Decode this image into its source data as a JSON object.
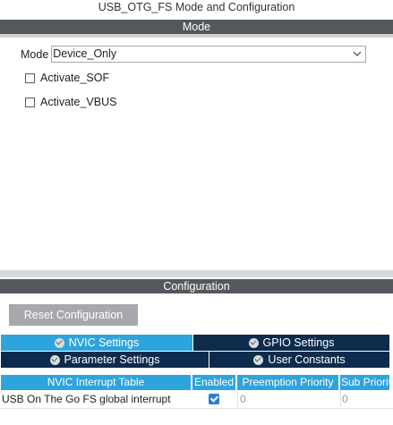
{
  "window": {
    "title": "USB_OTG_FS Mode and Configuration"
  },
  "mode_section": {
    "header": "Mode",
    "mode_label": "Mode",
    "mode_value": "Device_Only",
    "checkboxes": [
      {
        "label": "Activate_SOF",
        "checked": false
      },
      {
        "label": "Activate_VBUS",
        "checked": false
      }
    ]
  },
  "config_section": {
    "header": "Configuration",
    "reset_button": "Reset Configuration",
    "tabs": [
      {
        "label": "NVIC Settings",
        "active": true
      },
      {
        "label": "GPIO Settings",
        "active": false
      },
      {
        "label": "Parameter Settings",
        "active": false
      },
      {
        "label": "User Constants",
        "active": false
      }
    ],
    "nvic_table": {
      "columns": [
        "NVIC Interrupt Table",
        "Enabled",
        "Preemption Priority",
        "Sub Priority"
      ],
      "rows": [
        {
          "name": "USB On The Go FS global interrupt",
          "enabled": true,
          "preemption": "0",
          "sub": "0"
        }
      ]
    }
  },
  "colors": {
    "section_bar": "#54585d",
    "active_tab": "#2ea4dc",
    "inactive_tab": "#0d2b4c",
    "button": "#a6a8ab"
  }
}
